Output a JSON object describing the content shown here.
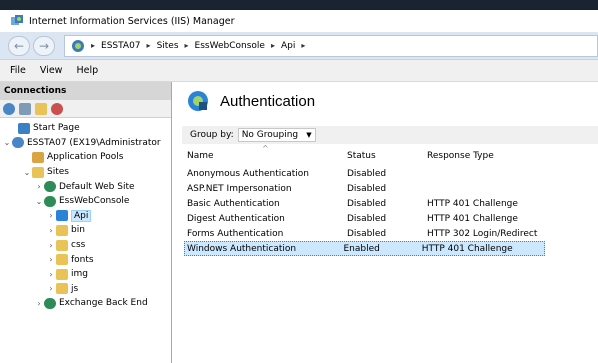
{
  "window": {
    "title": "Internet Information Services (IIS) Manager"
  },
  "address": {
    "crumbs": [
      "ESSTA07",
      "Sites",
      "EssWebConsole",
      "Api"
    ]
  },
  "menu": [
    "File",
    "View",
    "Help"
  ],
  "connections": {
    "header": "Connections",
    "tree": [
      {
        "label": "Start Page",
        "expander": "",
        "icon": "start-page-icon",
        "color": "#3b7fc4"
      },
      {
        "label": "ESSTA07 (EX19\\Administrator",
        "expander": "⌄",
        "icon": "server-icon",
        "color": "#4a86c5"
      },
      {
        "label": "Application Pools",
        "expander": "",
        "icon": "app-pools-icon",
        "color": "#d9a441"
      },
      {
        "label": "Sites",
        "expander": "⌄",
        "icon": "sites-folder-icon",
        "color": "#e9c258"
      },
      {
        "label": "Default Web Site",
        "expander": "›",
        "icon": "globe-icon",
        "color": "#2e8b57"
      },
      {
        "label": "EssWebConsole",
        "expander": "⌄",
        "icon": "globe-icon",
        "color": "#2e8b57"
      },
      {
        "label": "Api",
        "expander": "›",
        "icon": "application-icon",
        "color": "#2a83d6",
        "selected": true
      },
      {
        "label": "bin",
        "expander": "›",
        "icon": "folder-icon",
        "color": "#e9c258"
      },
      {
        "label": "css",
        "expander": "›",
        "icon": "folder-icon",
        "color": "#e9c258"
      },
      {
        "label": "fonts",
        "expander": "›",
        "icon": "folder-icon",
        "color": "#e9c258"
      },
      {
        "label": "img",
        "expander": "›",
        "icon": "folder-icon",
        "color": "#e9c258"
      },
      {
        "label": "js",
        "expander": "›",
        "icon": "folder-icon",
        "color": "#e9c258"
      },
      {
        "label": "Exchange Back End",
        "expander": "›",
        "icon": "globe-icon",
        "color": "#2e8b57"
      }
    ]
  },
  "main": {
    "title": "Authentication",
    "group_by_label": "Group by:",
    "group_by_value": "No Grouping",
    "columns": [
      "Name",
      "Status",
      "Response Type"
    ],
    "rows": [
      {
        "name": "Anonymous Authentication",
        "status": "Disabled",
        "response": ""
      },
      {
        "name": "ASP.NET Impersonation",
        "status": "Disabled",
        "response": ""
      },
      {
        "name": "Basic Authentication",
        "status": "Disabled",
        "response": "HTTP 401 Challenge"
      },
      {
        "name": "Digest Authentication",
        "status": "Disabled",
        "response": "HTTP 401 Challenge"
      },
      {
        "name": "Forms Authentication",
        "status": "Disabled",
        "response": "HTTP 302 Login/Redirect"
      },
      {
        "name": "Windows Authentication",
        "status": "Enabled",
        "response": "HTTP 401 Challenge",
        "selected": true
      }
    ]
  },
  "colors": {
    "accent": "#cce8ff",
    "nav_bg": "#dce6f2",
    "top_band": "#1a2330"
  }
}
